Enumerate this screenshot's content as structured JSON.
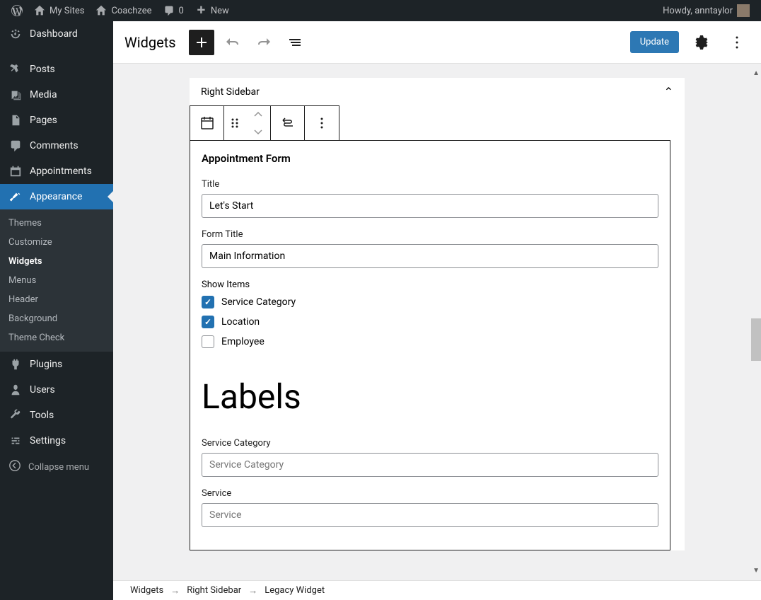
{
  "adminbar": {
    "my_sites": "My Sites",
    "site_name": "Coachzee",
    "comments": "0",
    "new": "New",
    "greeting": "Howdy, anntaylor"
  },
  "sidebar": {
    "items": [
      {
        "label": "Dashboard",
        "icon": "dashboard"
      },
      {
        "label": "Posts",
        "icon": "pin"
      },
      {
        "label": "Media",
        "icon": "media"
      },
      {
        "label": "Pages",
        "icon": "pages"
      },
      {
        "label": "Comments",
        "icon": "comments"
      },
      {
        "label": "Appointments",
        "icon": "calendar"
      },
      {
        "label": "Appearance",
        "icon": "brush"
      },
      {
        "label": "Plugins",
        "icon": "plug"
      },
      {
        "label": "Users",
        "icon": "users"
      },
      {
        "label": "Tools",
        "icon": "wrench"
      },
      {
        "label": "Settings",
        "icon": "sliders"
      }
    ],
    "submenu": [
      "Themes",
      "Customize",
      "Widgets",
      "Menus",
      "Header",
      "Background",
      "Theme Check"
    ],
    "collapse": "Collapse menu"
  },
  "editor": {
    "title": "Widgets",
    "update_btn": "Update",
    "area_title": "Right Sidebar"
  },
  "widget": {
    "heading": "Appointment Form",
    "title_label": "Title",
    "title_value": "Let's Start",
    "form_title_label": "Form Title",
    "form_title_value": "Main Information",
    "show_items_label": "Show Items",
    "checks": [
      {
        "label": "Service Category",
        "checked": true
      },
      {
        "label": "Location",
        "checked": true
      },
      {
        "label": "Employee",
        "checked": false
      }
    ],
    "labels_heading": "Labels",
    "service_category_label": "Service Category",
    "service_category_placeholder": "Service Category",
    "service_label": "Service",
    "service_placeholder": "Service"
  },
  "breadcrumb": [
    "Widgets",
    "Right Sidebar",
    "Legacy Widget"
  ]
}
